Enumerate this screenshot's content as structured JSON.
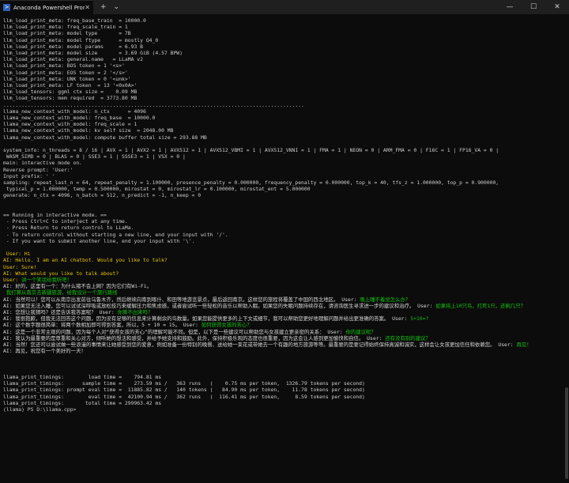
{
  "window": {
    "tab_title": "Anaconda Powershell Prompt",
    "tab_icon": "powershell-icon",
    "controls": {
      "new_tab": "+",
      "dropdown": "⌄",
      "minimize": "—",
      "maximize": "☐",
      "close": "✕",
      "tab_close": "✕"
    }
  },
  "lines": [
    {
      "t": "llm_load_print_meta: freq_base_train  = 10000.0"
    },
    {
      "t": "llm_load_print_meta: freq_scale_train = 1"
    },
    {
      "t": "llm_load_print_meta: model type       = 7B"
    },
    {
      "t": "llm_load_print_meta: model ftype      = mostly Q4_0"
    },
    {
      "t": "llm_load_print_meta: model params     = 6.93 B"
    },
    {
      "t": "llm_load_print_meta: model size       = 3.69 GiB (4.57 BPW)"
    },
    {
      "t": "llm_load_print_meta: general.name   = LLaMA v2"
    },
    {
      "t": "llm_load_print_meta: BOS token = 1 '<s>'"
    },
    {
      "t": "llm_load_print_meta: EOS token = 2 '</s>'"
    },
    {
      "t": "llm_load_print_meta: UNK token = 0 '<unk>'"
    },
    {
      "t": "llm_load_print_meta: LF token  = 13 '<0x0A>'"
    },
    {
      "t": "llm_load_tensors: ggml ctx size =    0.09 MB"
    },
    {
      "t": "llm_load_tensors: mem required  = 3773.80 MB"
    },
    {
      "t": "..................................................................................................."
    },
    {
      "t": "llama_new_context_with_model: n_ctx      = 4096"
    },
    {
      "t": "llama_new_context_with_model: freq_base  = 10000.0"
    },
    {
      "t": "llama_new_context_with_model: freq_scale = 1"
    },
    {
      "t": "llama_new_context_with_model: kv self size  = 2048.00 MB"
    },
    {
      "t": "llama_new_context_with_model: compute buffer total size = 293.88 MB"
    },
    {
      "t": ""
    },
    {
      "t": "system_info: n_threads = 8 / 16 | AVX = 1 | AVX2 = 1 | AVX512 = 1 | AVX512_VBMI = 1 | AVX512_VNNI = 1 | FMA = 1 | NEON = 0 | ARM_FMA = 0 | F16C = 1 | FP16_VA = 0 |"
    },
    {
      "t": " WASM_SIMD = 0 | BLAS = 0 | SSE3 = 1 | SSSE3 = 1 | VSX = 0 |"
    },
    {
      "t": "main: interactive mode on."
    },
    {
      "t": "Reverse prompt: 'User:'"
    },
    {
      "t": "Input prefix: ' '"
    },
    {
      "t": "sampling: repeat_last_n = 64, repeat_penalty = 1.100000, presence_penalty = 0.000000, frequency_penalty = 0.000000, top_k = 40, tfs_z = 1.000000, top_p = 0.900000,"
    },
    {
      "t": " typical_p = 1.000000, temp = 0.500000, mirostat = 0, mirostat_lr = 0.100000, mirostat_ent = 5.000000"
    },
    {
      "t": "generate: n_ctx = 4096, n_batch = 512, n_predict = -1, n_keep = 0"
    },
    {
      "t": ""
    },
    {
      "t": ""
    },
    {
      "t": "== Running in interactive mode. =="
    },
    {
      "t": " - Press Ctrl+C to interject at any time."
    },
    {
      "t": " - Press Return to return control to LLaMa."
    },
    {
      "t": " - To return control without starting a new line, end your input with '/'."
    },
    {
      "t": " - If you want to submit another line, end your input with '\\'."
    },
    {
      "t": ""
    },
    {
      "segs": [
        {
          "c": "y",
          "t": " User: Hi"
        }
      ]
    },
    {
      "segs": [
        {
          "c": "y",
          "t": "AI: Hello. I am an AI chatbot. Would you like to talk?"
        }
      ]
    },
    {
      "segs": [
        {
          "c": "y",
          "t": "User: Sure!"
        }
      ]
    },
    {
      "segs": [
        {
          "c": "y",
          "t": "AI: What would you like to talk about?"
        }
      ]
    },
    {
      "segs": [
        {
          "c": "y",
          "t": "User:"
        },
        {
          "c": "g",
          "t": " 讲一个笑话给我听吧！"
        }
      ]
    },
    {
      "segs": [
        {
          "c": "w",
          "t": "AI: 好的，这里有一个：为什么猪不会上网？因为它们有Wi-Fi。"
        }
      ]
    },
    {
      "segs": [
        {
          "c": "g",
          "t": " 我打算从南京去新疆旅游，给我设计一个旅行路线"
        }
      ]
    },
    {
      "segs": [
        {
          "c": "w",
          "t": "AI: 当然可以！您可以从南京出发前往乌鲁木齐，然后继续向南到喀什、和田等地游览景点，最后返回南京。这样您的旅程将覆盖了中国的西北地区。 User: "
        },
        {
          "c": "g",
          "t": "晚上睡不着觉怎么办？"
        }
      ],
      "wrap": true
    },
    {
      "segs": [
        {
          "c": "w",
          "t": "AI: 如果您无法入睡，您可以试试深呼吸或放松技巧来缓解压力和焦虑感，或者尝试听一些轻松的音乐以帮助入眠。如果您的失眠问题持续存在，请咨询医生寻求进一步的建议和治疗。 User: "
        },
        {
          "c": "g",
          "t": "如果将上10只鸟，打死1只，还剩几只？"
        }
      ],
      "wrap": true
    },
    {
      "segs": [
        {
          "c": "w",
          "t": "AI: 您想让我猜吗？还是告诉我答案呢？ User: "
        },
        {
          "c": "g",
          "t": "你算不出来吗？"
        }
      ]
    },
    {
      "segs": [
        {
          "c": "w",
          "t": "AI: 我很抱歉，但我无法回答这个问题，因为没有足够的信息来计算剩余的鸟数量。如果您能提供更多的上下文或细节，我可以帮助您更好地理解问题并给出更准确的答案。 User: "
        },
        {
          "c": "g",
          "t": "5+10=?"
        }
      ],
      "wrap": true
    },
    {
      "segs": [
        {
          "c": "w",
          "t": "AI: 这个数字题很简单：将两个数相加即可得到答案，所以，5 + 10 = 15。 User: "
        },
        {
          "c": "g",
          "t": "如何获得女孩的芳心？"
        }
      ]
    },
    {
      "segs": [
        {
          "c": "w",
          "t": "AI: 这是一个非常主观的问题，因为每个人对“获得女孩的芳心”的理解可能不同。但是，以下是一些建议可以帮助您与女孩建立更亲密的关系： User: "
        },
        {
          "c": "g",
          "t": "你的建议呢？"
        }
      ]
    },
    {
      "segs": [
        {
          "c": "w",
          "t": "AI: 我认为最重要的是尊重和关心对方，倾听她的想法和感受，并给予她支持和鼓励。此外，保持积极乐观的态度也很重要，因为这会让人感到更加愉快和自信。 User: "
        },
        {
          "c": "g",
          "t": "还有没有别的建议？"
        }
      ],
      "wrap": true
    },
    {
      "segs": [
        {
          "c": "w",
          "t": "AI: 当然！您还可以尝试做一些浪漫的事情来让她感受到您的爱意，例如准备一份特别的晚餐、送给她一束花或带她去一个有趣的地方旅游等等。最重要的是要记得始终保持真诚和诚实，这样会让女孩更加信任和依赖您。 User: "
        },
        {
          "c": "g",
          "t": "再见！"
        }
      ],
      "wrap": true
    },
    {
      "segs": [
        {
          "c": "w",
          "t": "AI: 再见，祝您有一个美好的一天！"
        }
      ]
    },
    {
      "t": ""
    },
    {
      "t": ""
    },
    {
      "t": ""
    },
    {
      "t": "llama_print_timings:        load time =    794.81 ms"
    },
    {
      "t": "llama_print_timings:      sample time =    273.59 ms /   363 runs   (    0.75 ms per token,  1326.79 tokens per second)"
    },
    {
      "t": "llama_print_timings: prompt eval time =  11885.82 ms /   140 tokens (   84.90 ms per token,    11.78 tokens per second)"
    },
    {
      "t": "llama_print_timings:        eval time =  42100.94 ms /   362 runs   (  116.41 ms per token,     8.59 tokens per second)"
    },
    {
      "t": "llama_print_timings:       total time = 299963.42 ms"
    },
    {
      "t": "(llama) PS D:\\llama.cpp>"
    }
  ]
}
